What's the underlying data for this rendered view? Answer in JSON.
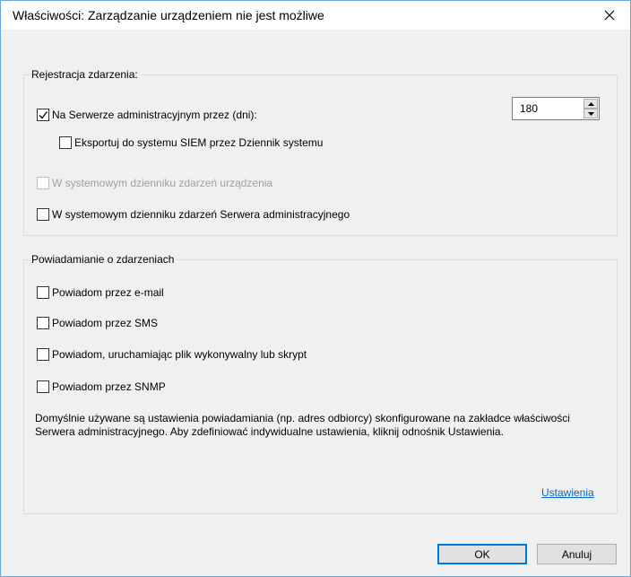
{
  "window": {
    "title": "Właściwości: Zarządzanie urządzeniem nie jest możliwe",
    "close_glyph": "✕"
  },
  "event_logging": {
    "legend": "Rejestracja zdarzenia:",
    "admin_server": {
      "label": "Na Serwerze administracyjnym przez (dni):",
      "checked": true
    },
    "days_value": "180",
    "siem_export": {
      "label": "Eksportuj do systemu SIEM przez Dziennik systemu",
      "checked": false
    },
    "device_log": {
      "label": "W systemowym dzienniku zdarzeń urządzenia",
      "checked": false,
      "disabled": true
    },
    "admin_log": {
      "label": "W systemowym dzienniku zdarzeń Serwera administracyjnego",
      "checked": false
    }
  },
  "notifications": {
    "legend": "Powiadamianie o zdarzeniach",
    "email": {
      "label": "Powiadom przez e-mail",
      "checked": false
    },
    "sms": {
      "label": "Powiadom przez SMS",
      "checked": false
    },
    "exec": {
      "label": "Powiadom, uruchamiając plik wykonywalny lub skrypt",
      "checked": false
    },
    "snmp": {
      "label": "Powiadom przez SNMP",
      "checked": false
    },
    "note": "Domyślnie używane są ustawienia powiadamiania (np. adres odbiorcy) skonfigurowane na zakładce właściwości Serwera administracyjnego. Aby zdefiniować indywidualne ustawienia, kliknij odnośnik Ustawienia.",
    "settings_link": "Ustawienia"
  },
  "buttons": {
    "ok": "OK",
    "cancel": "Anuluj"
  },
  "colors": {
    "border": "#6fa6d8",
    "link": "#0066cc",
    "default_button": "#0078d7"
  }
}
